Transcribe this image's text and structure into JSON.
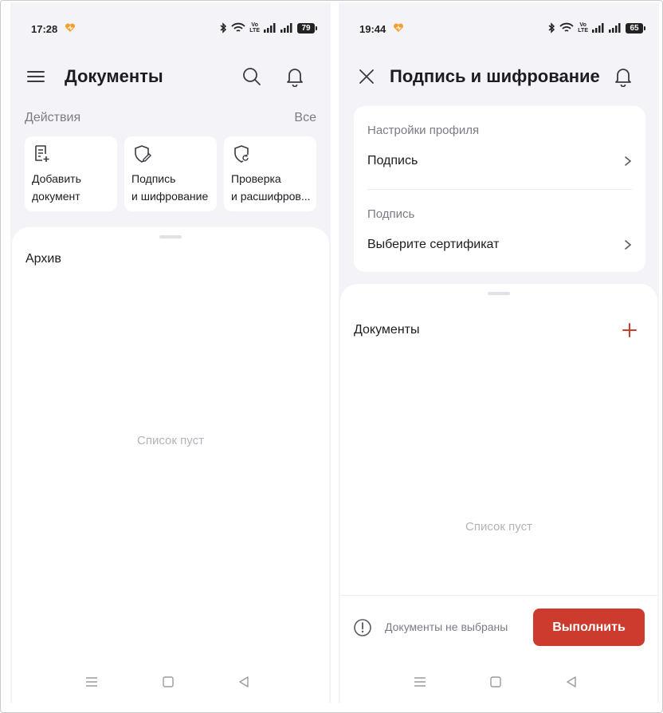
{
  "left_screen": {
    "status": {
      "time": "17:28",
      "volte": "Vo\nLTE",
      "battery": "79"
    },
    "header": {
      "title": "Документы"
    },
    "actions": {
      "label": "Действия",
      "all_label": "Все",
      "cards": [
        {
          "line1": "Добавить",
          "line2": "документ",
          "icon": "add-document-icon"
        },
        {
          "line1": "Подпись",
          "line2": "и шифрование",
          "icon": "shield-pen-icon"
        },
        {
          "line1": "Проверка",
          "line2": "и расшифров...",
          "icon": "shield-refresh-icon"
        }
      ]
    },
    "archive": {
      "title": "Архив",
      "empty_text": "Список пуст"
    }
  },
  "right_screen": {
    "status": {
      "time": "19:44",
      "volte": "Vo\nLTE",
      "battery": "65"
    },
    "header": {
      "title": "Подпись и шифрование"
    },
    "profile": {
      "settings_label": "Настройки профиля",
      "signature_value": "Подпись",
      "signature_label": "Подпись",
      "certificate_value": "Выберите сертификат"
    },
    "documents": {
      "title": "Документы",
      "empty_text": "Список пуст"
    },
    "footer": {
      "warning_text": "Документы не выбраны",
      "execute_label": "Выполнить"
    }
  },
  "colors": {
    "accent": "#cc3b2e",
    "background": "#f4f4f8",
    "muted_text": "#7b7b86"
  }
}
